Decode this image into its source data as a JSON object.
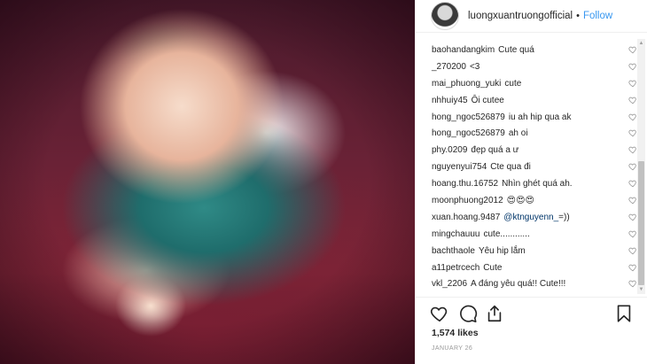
{
  "header": {
    "username": "luongxuantruong",
    "suffix": "official",
    "separator": "•",
    "follow_label": "Follow"
  },
  "comments": [
    {
      "user": "baohandangkim",
      "text": "Cute quá"
    },
    {
      "user": "_270200",
      "text": "<3"
    },
    {
      "user": "mai_phuong_yuki",
      "text": "cute"
    },
    {
      "user": "nhhuiy45",
      "text": "Ôi cutee"
    },
    {
      "user": "hong_ngoc526879",
      "text": "iu ah hip qua ak"
    },
    {
      "user": "hong_ngoc526879",
      "text": "ah oi"
    },
    {
      "user": "phy.0209",
      "text": "đẹp quá a ư"
    },
    {
      "user": "nguyenyui754",
      "text": "Cte qua đi"
    },
    {
      "user": "hoang.thu.16752",
      "text": "Nhìn ghét quá ah."
    },
    {
      "user": "moonphuong2012",
      "text": "😍😍😍"
    },
    {
      "user": "xuan.hoang.9487",
      "mention": "@ktnguyenn_",
      "text": " =))"
    },
    {
      "user": "mingchauuu",
      "text": "cute............"
    },
    {
      "user": "bachthaole",
      "text": "Yêu hip lắm"
    },
    {
      "user": "a11petrcech",
      "text": "Cute"
    },
    {
      "user": "vkl_2206",
      "text": "A đáng yêu quá!! Cute!!!"
    }
  ],
  "likes": "1,574 likes",
  "date": "JANUARY 26",
  "icons": {
    "like": "heart-outline-icon",
    "comment": "comment-bubble-icon",
    "share": "share-arrow-icon",
    "save": "bookmark-icon"
  },
  "colors": {
    "link": "#3897f0",
    "mention": "#003569",
    "muted": "#999999"
  }
}
